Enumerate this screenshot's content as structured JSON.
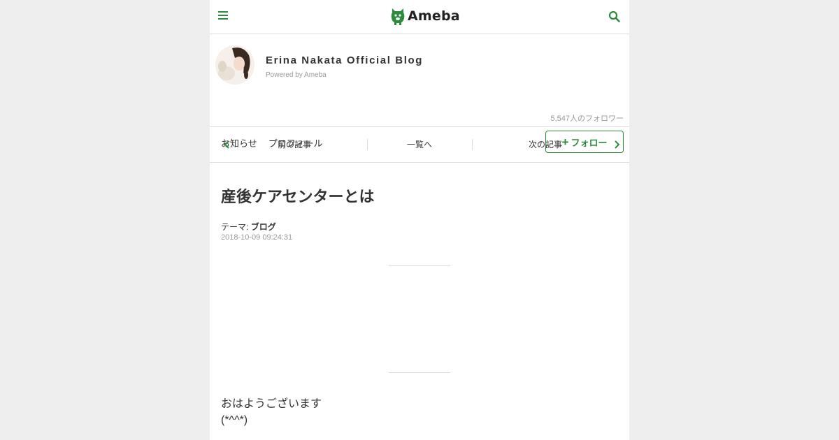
{
  "header": {
    "logo_text": "Ameba",
    "brand_color": "#2d8c3c",
    "menu_icon": "hamburger-menu-icon",
    "search_icon": "search-icon"
  },
  "blog": {
    "title": "Erina Nakata Official Blog",
    "powered_by": "Powered by Ameba",
    "followers": "5,547人のフォロワー",
    "nav": [
      "お知らせ",
      "プロフィール"
    ],
    "follow_label": "フォロー"
  },
  "pager": {
    "prev": "前の記事",
    "list": "一覧へ",
    "next": "次の記事"
  },
  "article": {
    "title": "産後ケアセンターとは",
    "theme_label": "テーマ:",
    "theme": "ブログ",
    "date": "2018-10-09 09:24:31",
    "body": [
      "おはようございます",
      "(*^^*)"
    ]
  }
}
